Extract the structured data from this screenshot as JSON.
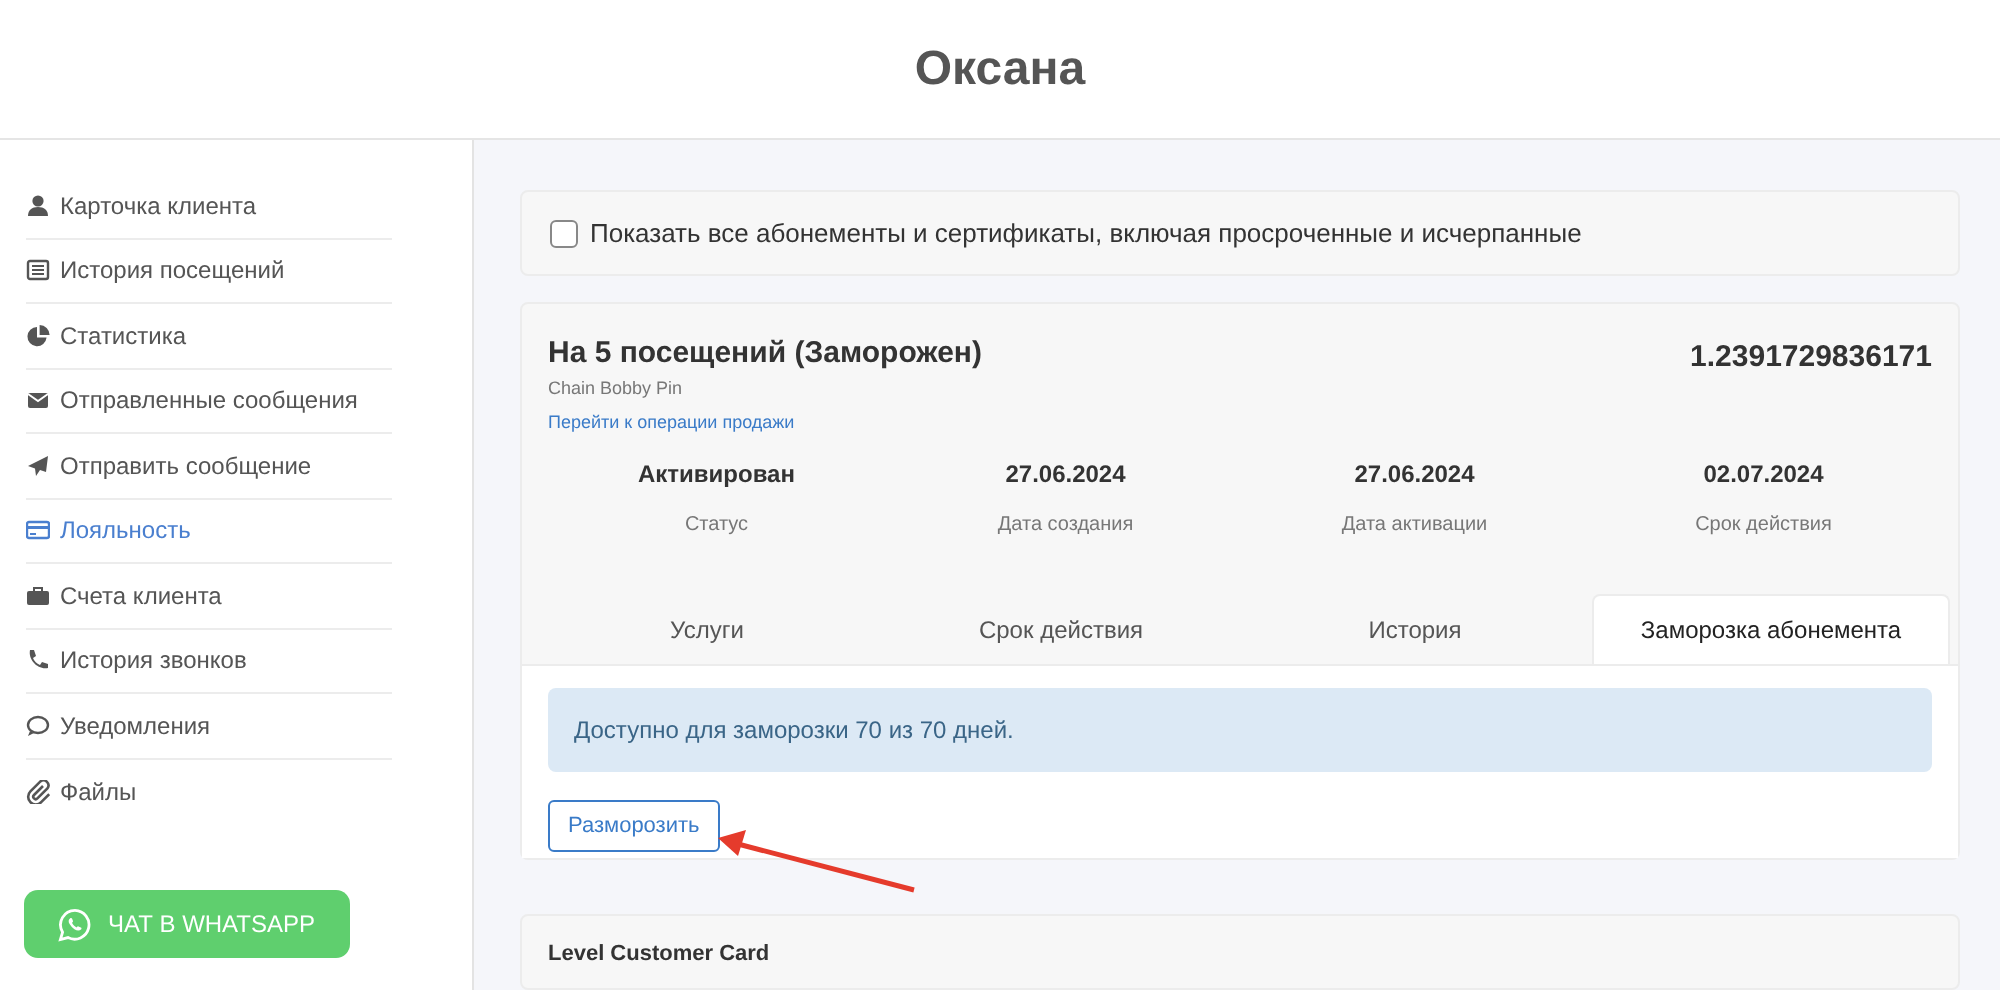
{
  "header": {
    "title": "Оксана"
  },
  "sidebar": {
    "items": [
      {
        "label": "Карточка клиента",
        "kind": "user",
        "selected": false
      },
      {
        "label": "История посещений",
        "kind": "list",
        "selected": false
      },
      {
        "label": "Статистика",
        "kind": "pie",
        "selected": false
      },
      {
        "label": "Отправленные сообщения",
        "kind": "envelope",
        "selected": false
      },
      {
        "label": "Отправить сообщение",
        "kind": "send",
        "selected": false
      },
      {
        "label": "Лояльность",
        "kind": "card",
        "selected": true
      },
      {
        "label": "Счета клиента",
        "kind": "briefcase",
        "selected": false
      },
      {
        "label": "История звонков",
        "kind": "phone",
        "selected": false
      },
      {
        "label": "Уведомления",
        "kind": "comment",
        "selected": false
      },
      {
        "label": "Файлы",
        "kind": "clip",
        "selected": false
      }
    ],
    "whatsapp_button": "ЧАТ В WHATSAPP"
  },
  "filter": {
    "label": "Показать все абонементы и сертификаты, включая просроченные и исчерпанные",
    "checked": false
  },
  "subscription": {
    "title": "На 5 посещений (Заморожен)",
    "number": "1.2391729836171",
    "subtitle": "Chain Bobby Pin",
    "link": "Перейти к операции продажи",
    "stats": [
      {
        "value": "Активирован",
        "label": "Статус"
      },
      {
        "value": "27.06.2024",
        "label": "Дата создания"
      },
      {
        "value": "27.06.2024",
        "label": "Дата активации"
      },
      {
        "value": "02.07.2024",
        "label": "Срок действия"
      }
    ],
    "tabs": [
      {
        "label": "Услуги",
        "selected": false
      },
      {
        "label": "Срок действия",
        "selected": false
      },
      {
        "label": "История",
        "selected": false
      },
      {
        "label": "Заморозка абонемента",
        "selected": true
      }
    ],
    "info": "Доступно для заморозки 70 из 70 дней.",
    "button": "Разморозить"
  },
  "next_card": {
    "title": "Level Customer Card"
  }
}
